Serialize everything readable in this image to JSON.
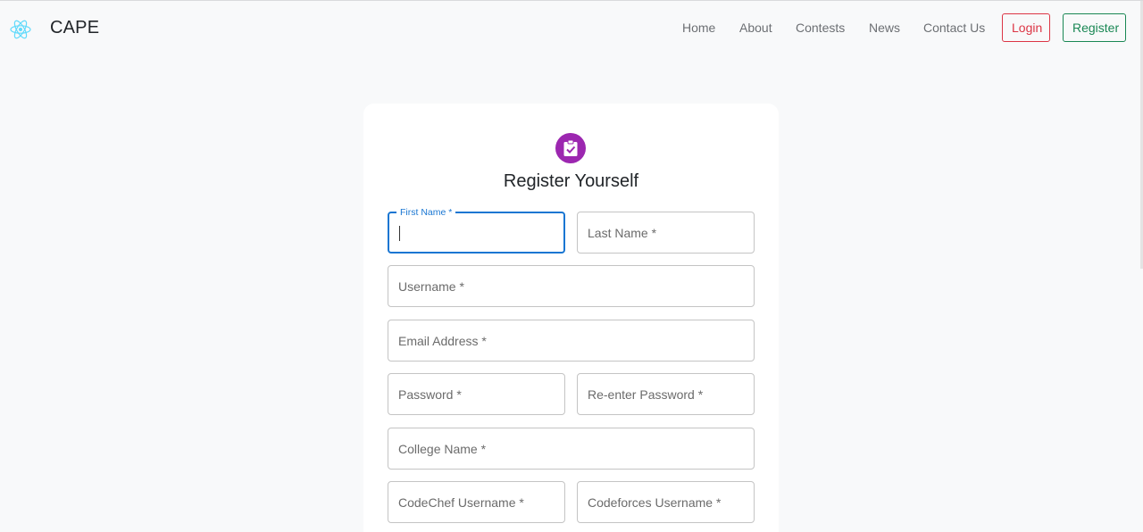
{
  "brand": {
    "name": "CAPE",
    "logo_icon": "react-atom-icon",
    "logo_color": "#61dafb"
  },
  "nav": {
    "links": [
      "Home",
      "About",
      "Contests",
      "News",
      "Contact Us"
    ],
    "login_label": "Login",
    "register_label": "Register"
  },
  "form": {
    "icon": "assignment-turned-in-icon",
    "icon_bg": "#9c27b0",
    "title": "Register Yourself",
    "fields": {
      "first_name": "First Name *",
      "last_name": "Last Name *",
      "username": "Username *",
      "email": "Email Address *",
      "password": "Password *",
      "reenter_password": "Re-enter Password *",
      "college": "College Name *",
      "codechef": "CodeChef Username *",
      "codeforces": "Codeforces Username *"
    },
    "focus_color": "#1976d2"
  }
}
